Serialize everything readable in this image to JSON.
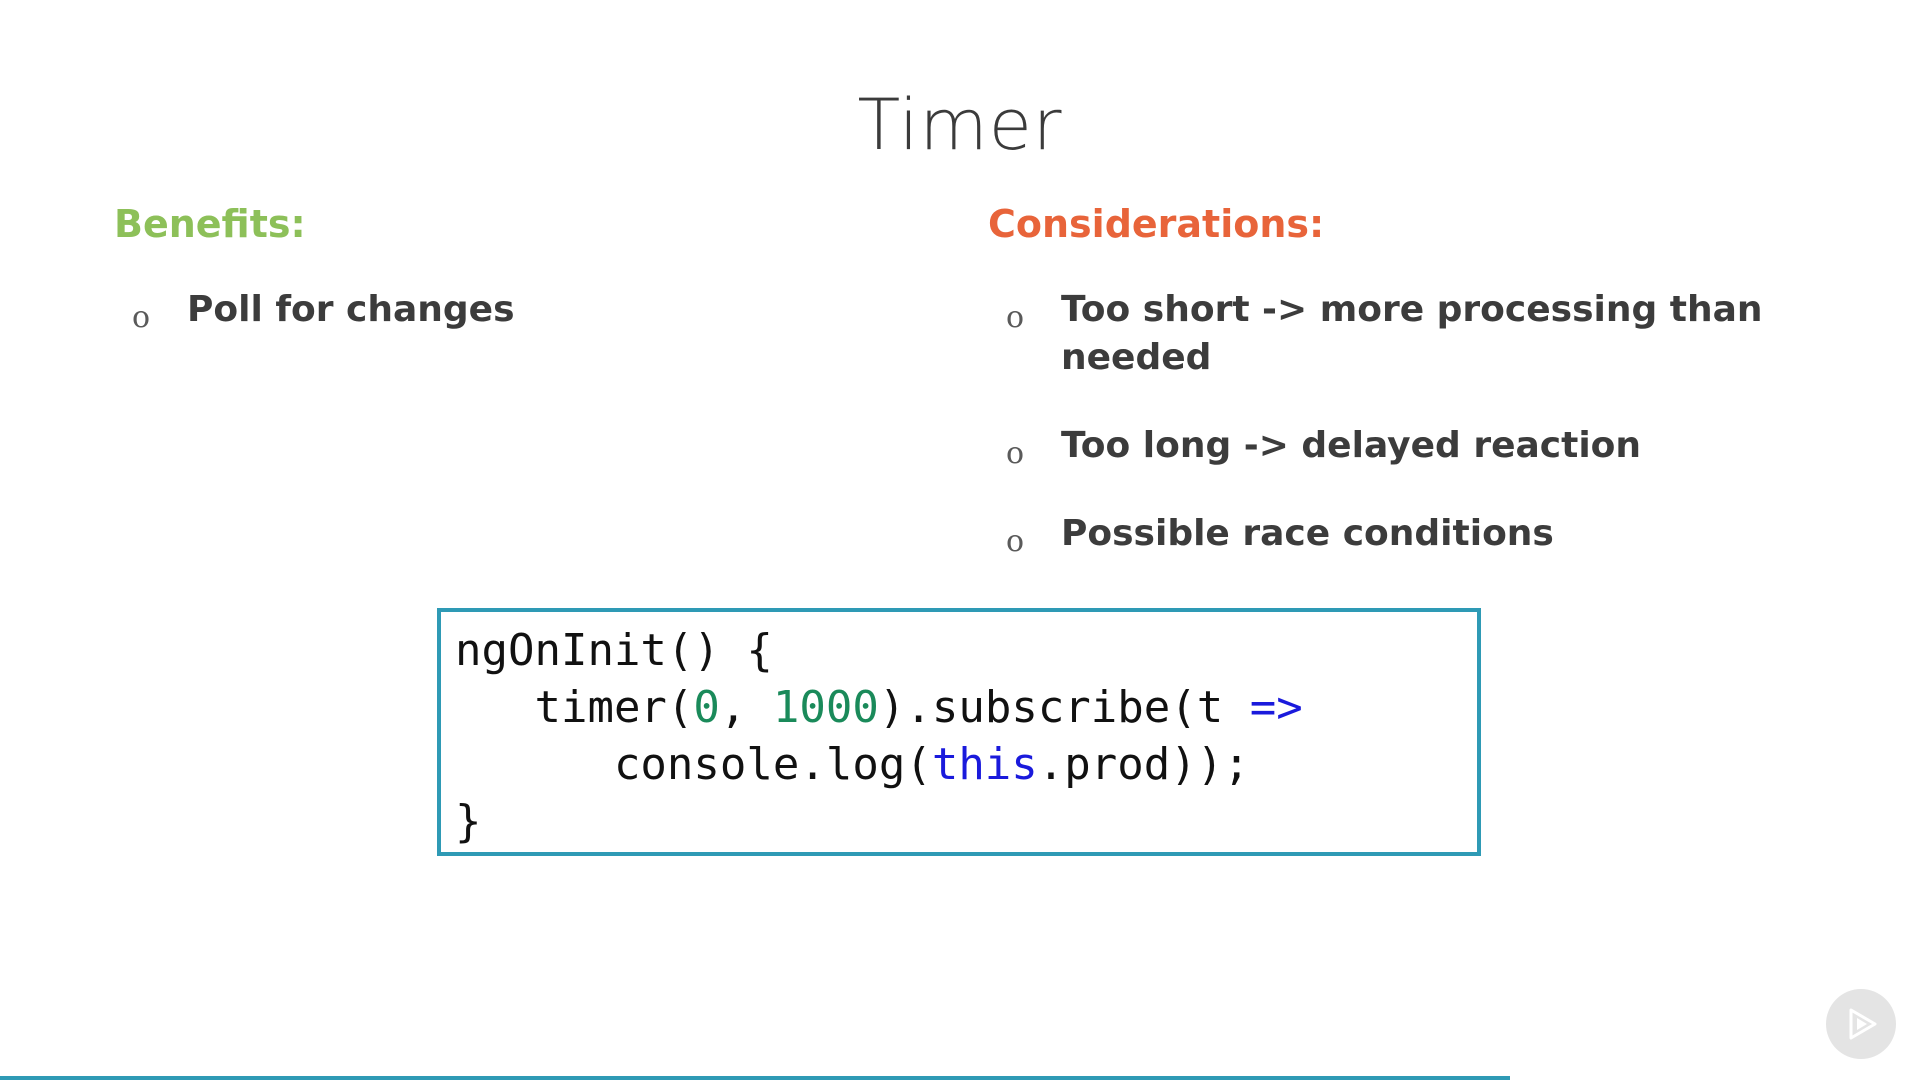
{
  "slide": {
    "title": "Timer"
  },
  "benefits": {
    "heading": "Benefits:",
    "heading_color": "#8dc059",
    "bullet_marker": "o",
    "items": [
      "Poll for changes"
    ]
  },
  "considerations": {
    "heading": "Considerations:",
    "heading_color": "#e8643a",
    "bullet_marker": "o",
    "items": [
      "Too short -> more processing than needed",
      "Too long -> delayed reaction",
      "Possible race conditions"
    ]
  },
  "code": {
    "line1": "ngOnInit() {",
    "line2_a": "   timer(",
    "line2_num1": "0",
    "line2_b": ", ",
    "line2_num2": "1000",
    "line2_c": ").subscribe(t ",
    "line2_arrow": "=>",
    "line3_a": "      console.log(",
    "line3_kw": "this",
    "line3_b": ".prod));",
    "line4": "}"
  },
  "colors": {
    "accent": "#2e9ab5",
    "code_number": "#1a8a5a",
    "code_keyword": "#1a1adc"
  },
  "icons": {
    "play": "play-icon"
  }
}
